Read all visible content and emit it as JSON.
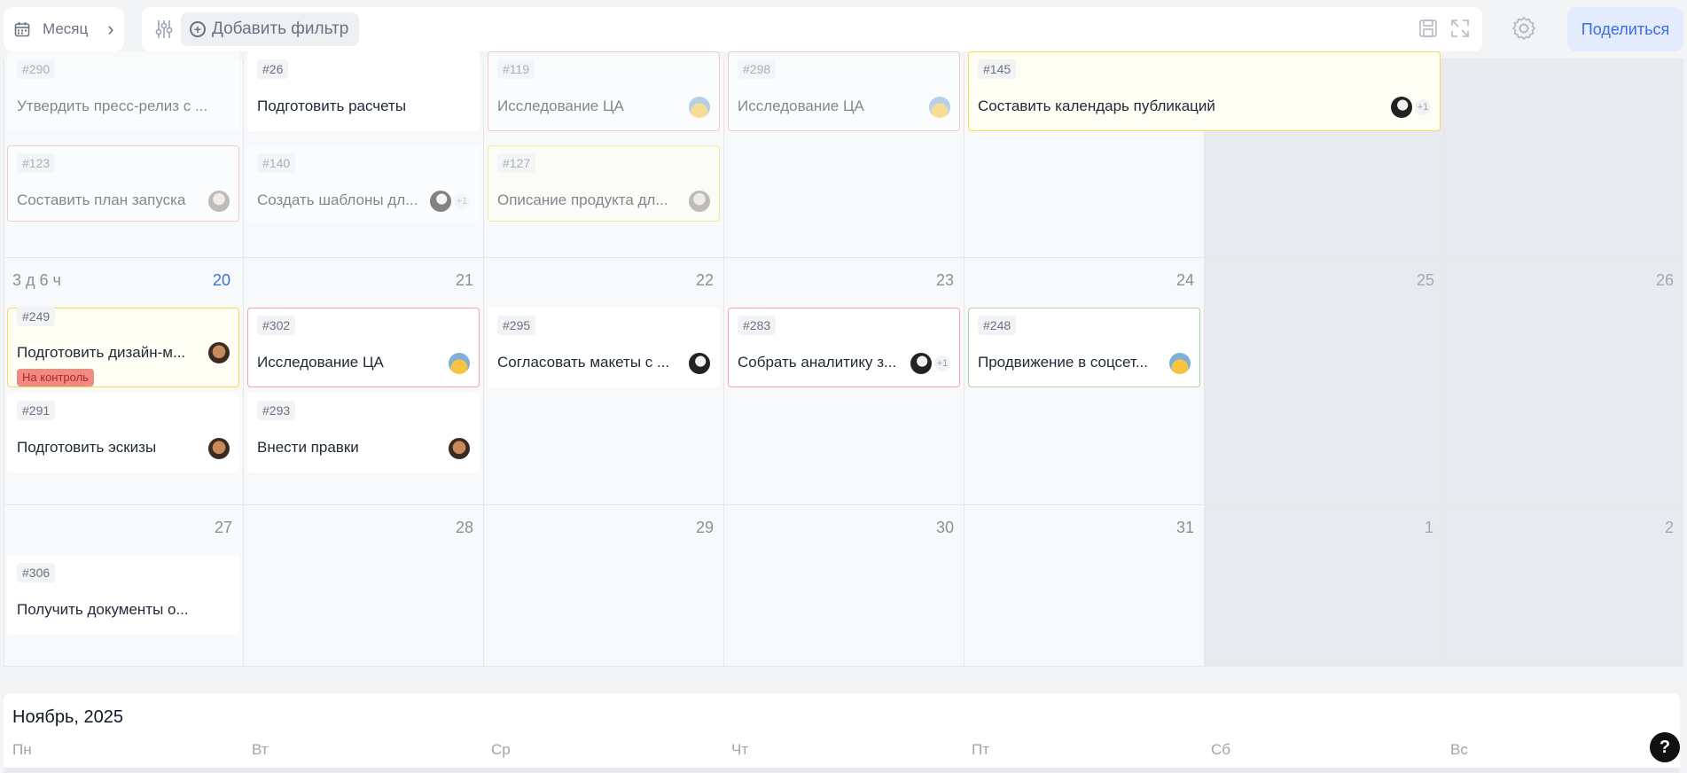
{
  "topbar": {
    "view_label": "Месяц",
    "add_filter_label": "Добавить фильтр",
    "share_label": "Поделиться",
    "icons": [
      "calendar-icon",
      "chevron-right-icon",
      "sliders-icon",
      "plus-circle-icon",
      "save-icon",
      "expand-icon",
      "gear-icon"
    ]
  },
  "colors": {
    "accent": "#3b6fe0",
    "red_border": "#f3a5a5",
    "yellow_border": "#f2dc55",
    "green_border": "#a7d99a",
    "badge": "#f08b84"
  },
  "weeks": [
    {
      "days": [
        "",
        "",
        "",
        "",
        "",
        "",
        ""
      ]
    },
    {
      "overdue": "3 д 6 ч",
      "days": [
        "20",
        "21",
        "22",
        "23",
        "24",
        "25",
        "26"
      ]
    },
    {
      "days": [
        "27",
        "28",
        "29",
        "30",
        "31",
        "1",
        "2"
      ]
    }
  ],
  "tasks": {
    "t290": {
      "id": "#290",
      "title": "Утвердить пресс-релиз с ..."
    },
    "t26": {
      "id": "#26",
      "title": "Подготовить расчеты"
    },
    "t119": {
      "id": "#119",
      "title": "Исследование ЦА"
    },
    "t298": {
      "id": "#298",
      "title": "Исследование ЦА"
    },
    "t145": {
      "id": "#145",
      "title": "Составить календарь публикаций",
      "extra": "+1"
    },
    "t123": {
      "id": "#123",
      "title": "Составить план запуска"
    },
    "t140": {
      "id": "#140",
      "title": "Создать шаблоны дл...",
      "extra": "+1"
    },
    "t127": {
      "id": "#127",
      "title": "Описание продукта дл..."
    },
    "t249": {
      "id": "#249",
      "title": "Подготовить дизайн-м...",
      "badge": "На контроль"
    },
    "t302": {
      "id": "#302",
      "title": "Исследование ЦА"
    },
    "t295": {
      "id": "#295",
      "title": "Согласовать макеты с ..."
    },
    "t283": {
      "id": "#283",
      "title": "Собрать аналитику з...",
      "extra": "+1"
    },
    "t248": {
      "id": "#248",
      "title": "Продвижение в соцсет..."
    },
    "t291": {
      "id": "#291",
      "title": "Подготовить эскизы"
    },
    "t293": {
      "id": "#293",
      "title": "Внести правки"
    },
    "t306": {
      "id": "#306",
      "title": "Получить документы о..."
    }
  },
  "next_month": {
    "title": "Ноябрь, 2025",
    "weekdays": [
      "Пн",
      "Вт",
      "Ср",
      "Чт",
      "Пт",
      "Сб",
      "Вс"
    ]
  },
  "help_label": "?"
}
